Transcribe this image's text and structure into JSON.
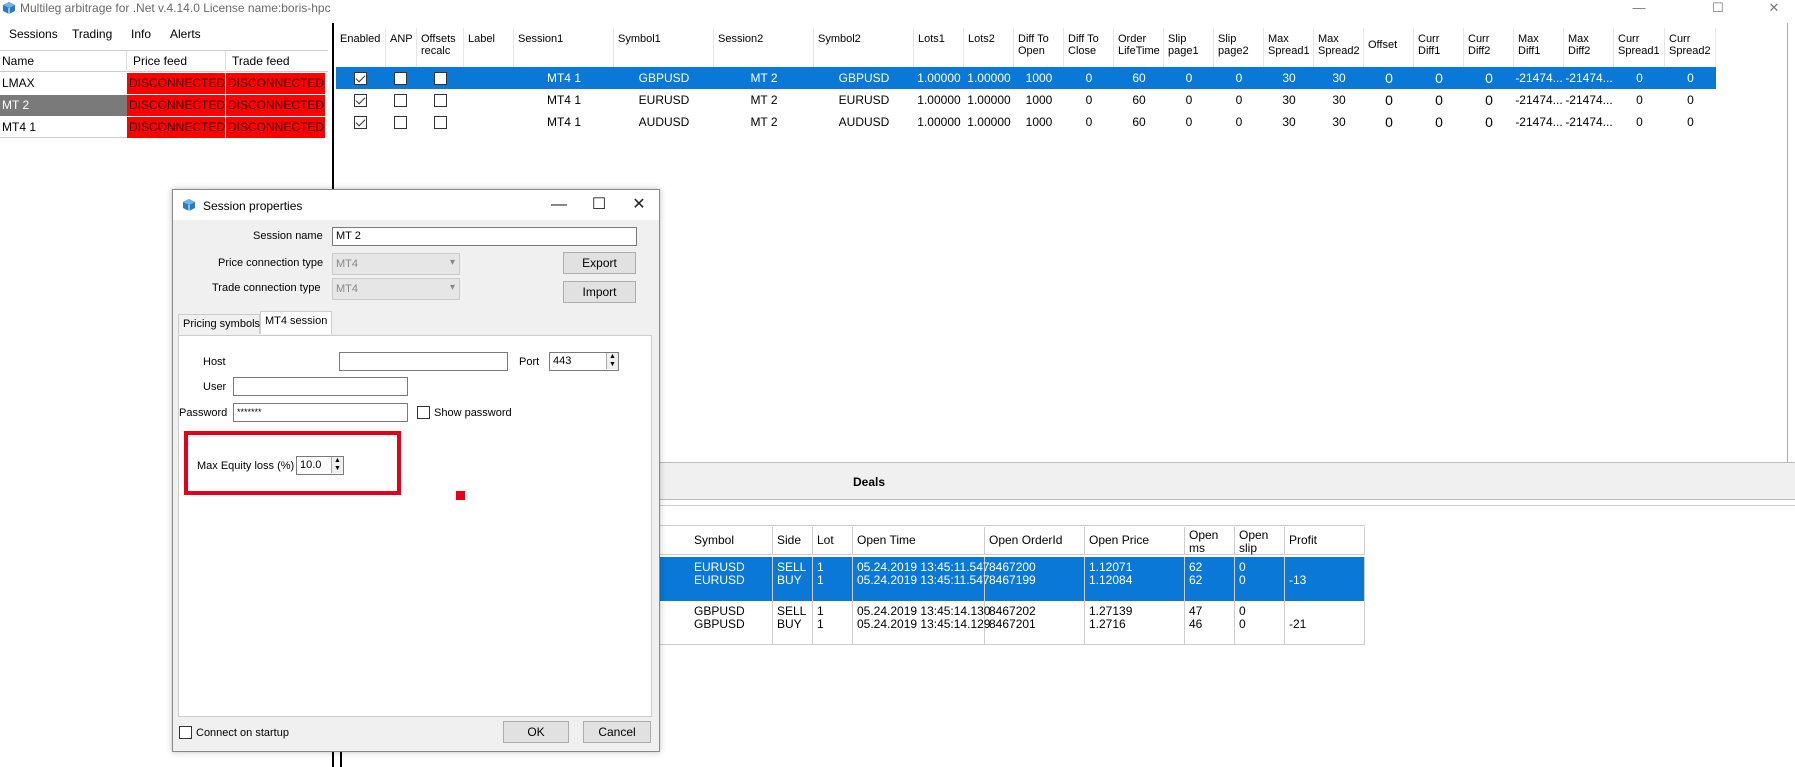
{
  "window": {
    "title": "Multileg arbitrage for .Net v.4.14.0 License name:boris-hpc",
    "min": "—",
    "max": "☐",
    "close": "✕"
  },
  "menu": [
    "Sessions",
    "Trading",
    "Info",
    "Alerts"
  ],
  "sessions_table": {
    "headers": [
      "Name",
      "Price feed",
      "Trade feed"
    ],
    "rows": [
      {
        "name": "LMAX",
        "price": "DISCONNECTED",
        "trade": "DISCONNECTED"
      },
      {
        "name": "MT 2",
        "price": "DISCONNECTED",
        "trade": "DISCONNECTED"
      },
      {
        "name": "MT4 1",
        "price": "DISCONNECTED",
        "trade": "DISCONNECTED"
      }
    ]
  },
  "grid": {
    "headers": [
      "Enabled",
      "ANP",
      "Offsets recalc",
      "Label",
      "Session1",
      "Symbol1",
      "Session2",
      "Symbol2",
      "Lots1",
      "Lots2",
      "Diff To Open",
      "Diff To Close",
      "Order LifeTime",
      "Slip page1",
      "Slip page2",
      "Max Spread1",
      "Max Spread2",
      "Offset",
      "Curr Diff1",
      "Curr Diff2",
      "Max Diff1",
      "Max Diff2",
      "Curr Spread1",
      "Curr Spread2"
    ],
    "rows": [
      {
        "session1": "MT4 1",
        "symbol1": "GBPUSD",
        "session2": "MT 2",
        "symbol2": "GBPUSD",
        "lots1": "1.00000",
        "lots2": "1.00000",
        "dto": "1000",
        "dtc": "0",
        "life": "60",
        "slip1": "0",
        "slip2": "0",
        "ms1": "30",
        "ms2": "30",
        "offset": "0",
        "cd1": "0",
        "cd2": "0",
        "md1": "-21474...",
        "md2": "-21474...",
        "cs1": "0",
        "cs2": "0"
      },
      {
        "session1": "MT4 1",
        "symbol1": "EURUSD",
        "session2": "MT 2",
        "symbol2": "EURUSD",
        "lots1": "1.00000",
        "lots2": "1.00000",
        "dto": "1000",
        "dtc": "0",
        "life": "60",
        "slip1": "0",
        "slip2": "0",
        "ms1": "30",
        "ms2": "30",
        "offset": "0",
        "cd1": "0",
        "cd2": "0",
        "md1": "-21474...",
        "md2": "-21474...",
        "cs1": "0",
        "cs2": "0"
      },
      {
        "session1": "MT4 1",
        "symbol1": "AUDUSD",
        "session2": "MT 2",
        "symbol2": "AUDUSD",
        "lots1": "1.00000",
        "lots2": "1.00000",
        "dto": "1000",
        "dtc": "0",
        "life": "60",
        "slip1": "0",
        "slip2": "0",
        "ms1": "30",
        "ms2": "30",
        "offset": "0",
        "cd1": "0",
        "cd2": "0",
        "md1": "-21474...",
        "md2": "-21474...",
        "cs1": "0",
        "cs2": "0"
      }
    ]
  },
  "deals": {
    "title": "Deals",
    "headers": [
      "Symbol",
      "Side",
      "Lot",
      "Open Time",
      "Open OrderId",
      "Open Price",
      "Open ms",
      "Open slip",
      "Profit"
    ],
    "rows": [
      {
        "symbol": "EURUSD\nEURUSD",
        "side": "SELL\nBUY",
        "lot": "1\n1",
        "time": "05.24.2019 13:45:11.547\n05.24.2019 13:45:11.547",
        "orderid": "8467200\n8467199",
        "price": "1.12071\n1.12084",
        "ms": "62\n62",
        "slip": "0\n0",
        "profit": "-13"
      },
      {
        "symbol": "GBPUSD\nGBPUSD",
        "side": "SELL\nBUY",
        "lot": "1\n1",
        "time": "05.24.2019 13:45:14.130\n05.24.2019 13:45:14.129",
        "orderid": "8467202\n8467201",
        "price": "1.27139\n1.2716",
        "ms": "47\n46",
        "slip": "0\n0",
        "profit": "-21"
      }
    ]
  },
  "dialog": {
    "title": "Session properties",
    "session_name_label": "Session name",
    "session_name_value": "MT 2",
    "price_conn_label": "Price connection type",
    "price_conn_value": "MT4",
    "trade_conn_label": "Trade connection type",
    "trade_conn_value": "MT4",
    "export_label": "Export",
    "import_label": "Import",
    "tabs": [
      "Pricing symbols",
      "MT4 session"
    ],
    "host_label": "Host",
    "host_value": "",
    "port_label": "Port",
    "port_value": "443",
    "user_label": "User",
    "user_value": "",
    "password_label": "Password",
    "password_value": "*******",
    "show_password_label": "Show password",
    "max_equity_label": "Max Equity loss (%)",
    "max_equity_value": "10.0",
    "connect_startup_label": "Connect on startup",
    "ok_label": "OK",
    "cancel_label": "Cancel"
  },
  "colors": {
    "accent": "#0a78d7",
    "disconnected": "#ff0000",
    "annotation": "#e3001b"
  }
}
